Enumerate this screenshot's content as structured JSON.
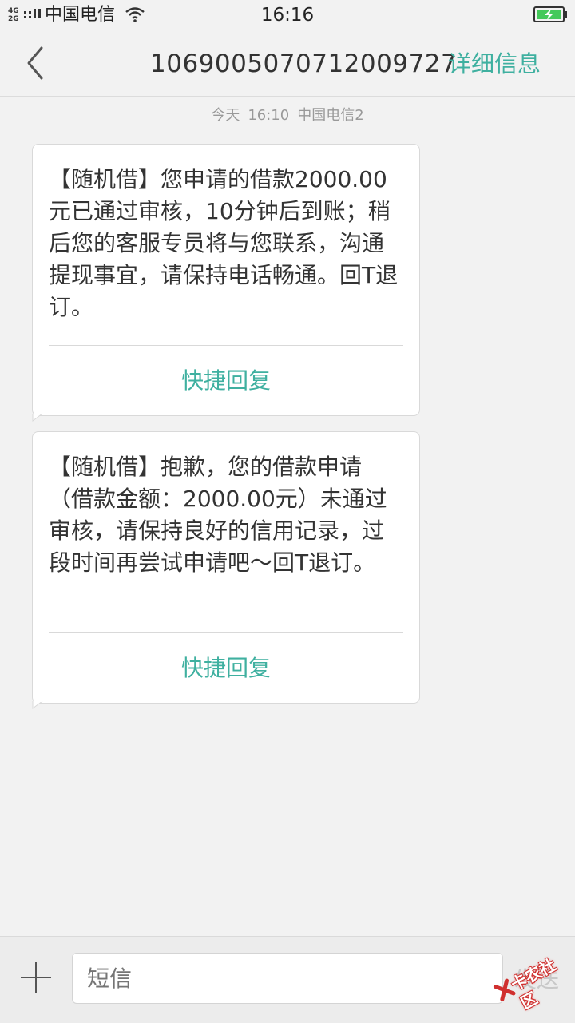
{
  "status_bar": {
    "network_top": "4G",
    "network_bottom": "2G",
    "carrier": "中国电信",
    "time": "16:16",
    "icons": [
      "signal-icon",
      "wifi-icon",
      "battery-charging-icon"
    ]
  },
  "header": {
    "back_icon": "chevron-left-icon",
    "title": "1069005070712009727",
    "details_label": "详细信息"
  },
  "thread": {
    "timestamp_day": "今天",
    "timestamp_time": "16:10",
    "timestamp_sim": "中国电信2",
    "messages": [
      {
        "text": "【随机借】您申请的借款2000.00元已通过审核，10分钟后到账；稍后您的客服专员将与您联系，沟通提现事宜，请保持电话畅通。回T退订。",
        "quick_reply_label": "快捷回复"
      },
      {
        "text": "【随机借】抱歉，您的借款申请（借款金额：2000.00元）未通过审核，请保持良好的信用记录，过段时间再尝试申请吧～回T退订。",
        "quick_reply_label": "快捷回复"
      }
    ]
  },
  "composer": {
    "add_icon": "plus-icon",
    "placeholder": "短信",
    "send_label": "发送"
  },
  "watermark": {
    "text": "卡农社区"
  },
  "colors": {
    "accent": "#3fb0a0",
    "background": "#f2f2f2",
    "bubble": "#ffffff",
    "watermark": "#d0302f"
  }
}
